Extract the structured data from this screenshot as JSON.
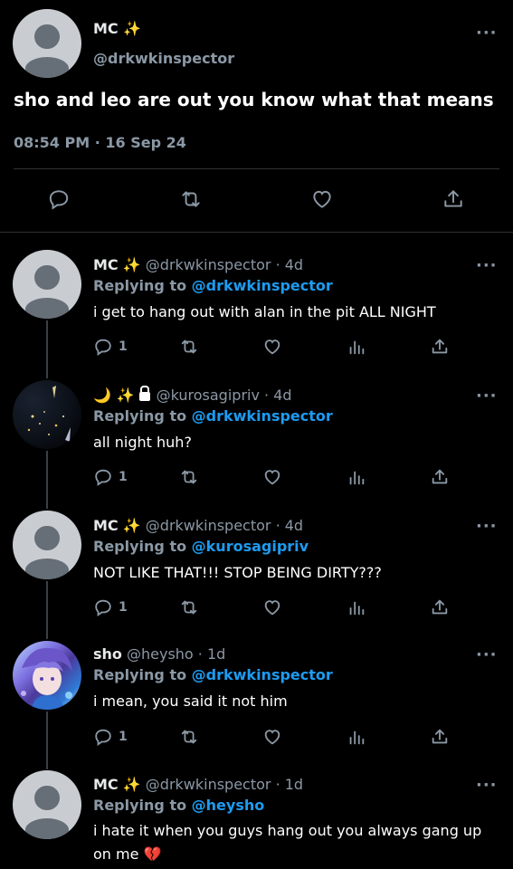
{
  "main_tweet": {
    "author_name": "MC",
    "author_emoji": "✨",
    "handle": "@drkwkinspector",
    "text": "sho and leo are out you know what that means",
    "timestamp": "08:54 PM · 16 Sep 24",
    "more_label": "···"
  },
  "replies": [
    {
      "name": "MC",
      "name_emoji": "✨",
      "meta": "@drkwkinspector · 4d",
      "replying_prefix": "Replying to ",
      "replying_to": "@drkwkinspector",
      "text": "i get to hang out with alan in the pit ALL NIGHT",
      "reply_count": "1",
      "avatar": "default"
    },
    {
      "name": "🌙 ✨",
      "name_emoji": "",
      "meta": "@kurosagipriv · 4d",
      "replying_prefix": "Replying to ",
      "replying_to": "@drkwkinspector",
      "text": "all night huh?",
      "reply_count": "1",
      "avatar": "night-sky",
      "locked": true
    },
    {
      "name": "MC",
      "name_emoji": "✨",
      "meta": "@drkwkinspector · 4d",
      "replying_prefix": "Replying to ",
      "replying_to": "@kurosagipriv",
      "text": "NOT LIKE THAT!!! STOP BEING DIRTY???",
      "reply_count": "1",
      "avatar": "default"
    },
    {
      "name": "sho",
      "name_emoji": "",
      "meta": "@heysho · 1d",
      "replying_prefix": "Replying to ",
      "replying_to": "@drkwkinspector",
      "text": "i mean, you said it not him",
      "reply_count": "1",
      "avatar": "sho"
    },
    {
      "name": "MC",
      "name_emoji": "✨",
      "meta": "@drkwkinspector · 1d",
      "replying_prefix": "Replying to ",
      "replying_to": "@heysho",
      "text": "i hate it when you guys hang out you always gang up on me 💔",
      "reply_count": "",
      "avatar": "default"
    }
  ],
  "icons": {
    "reply": "reply-icon",
    "retweet": "retweet-icon",
    "like": "heart-icon",
    "share": "share-icon",
    "views": "analytics-icon",
    "more": "more-icon"
  },
  "colors": {
    "background": "#000000",
    "text": "#e7e9ea",
    "muted": "#8b98a5",
    "link": "#1d9bf0",
    "divider": "#2f3336"
  }
}
